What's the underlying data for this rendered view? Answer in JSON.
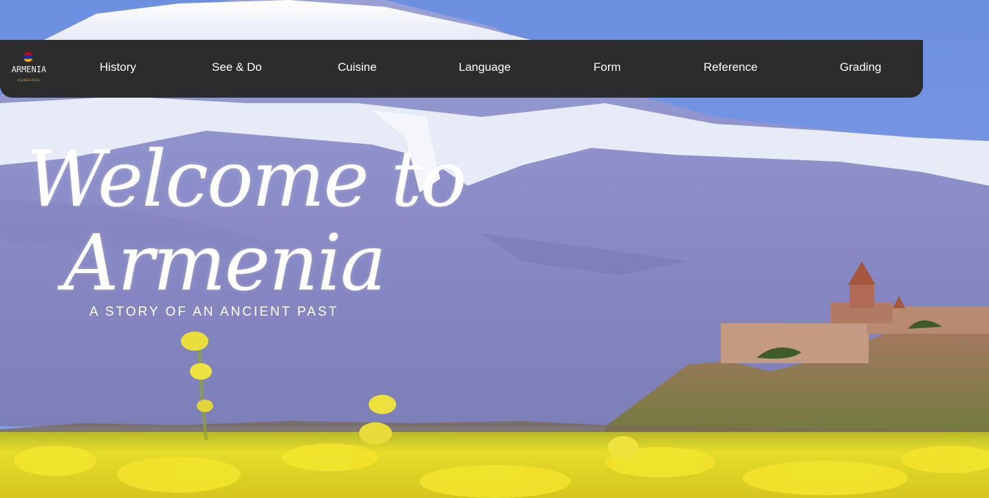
{
  "logo": {
    "text": "ARMENIA",
    "subtext": "ՀԱՅԱՍՏԱՆ"
  },
  "nav": {
    "items": [
      {
        "label": "History"
      },
      {
        "label": "See & Do"
      },
      {
        "label": "Cuisine"
      },
      {
        "label": "Language"
      },
      {
        "label": "Form"
      },
      {
        "label": "Reference"
      },
      {
        "label": "Grading"
      }
    ]
  },
  "hero": {
    "title_line1": "Welcome to",
    "title_line2": "Armenia",
    "tagline": "A STORY OF AN ANCIENT PAST"
  }
}
